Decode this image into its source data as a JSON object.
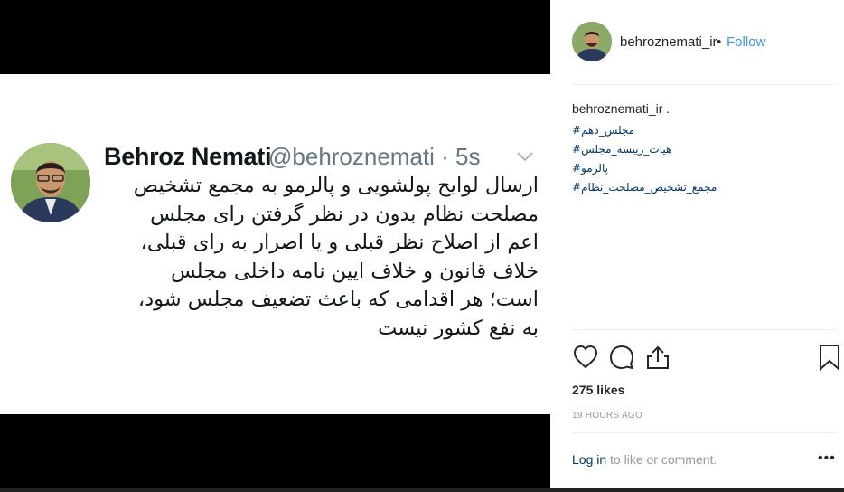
{
  "tweet": {
    "name": "Behroz Nemati",
    "handle_time": "@behroznemati · 5s",
    "lines": [
      "ارسال لوایح پولشویی و پالرمو به مجمع تشخیص",
      "مصلحت نظام بدون در نظر گرفتن رای مجلس",
      "اعم از اصلاح نظر قبلی و یا اصرار به رای قبلی،",
      "خلاف قانون و خلاف ایین نامه داخلی مجلس",
      "است؛ هر اقدامی که باعث تضعیف مجلس شود،",
      "به نفع کشور نیست"
    ]
  },
  "post": {
    "username": "behroznemati_ir",
    "dot": "•",
    "follow_label": "Follow",
    "caption_user": "behroznemati_ir .",
    "hashtags": [
      "#مجلس_دهم",
      "#هیات_رییسه_مجلس",
      "#پالرمو",
      "#مجمع_تشخیص_مصلحت_نظام"
    ],
    "likes": "275 likes",
    "time_ago": "19 HOURS AGO",
    "login_label": "Log in",
    "comment_prompt": " to like or comment.",
    "more_label": "•••"
  },
  "icons": {
    "like": "heart-icon",
    "comment": "comment-icon",
    "share": "share-icon",
    "save": "bookmark-icon",
    "tweet_menu": "chevron-down-icon"
  }
}
